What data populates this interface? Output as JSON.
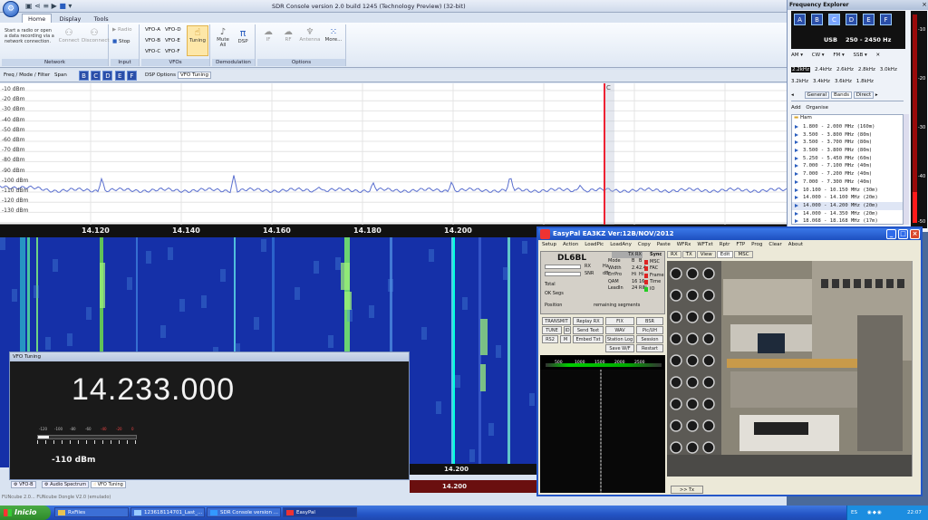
{
  "app": {
    "title": "SDR Console version 2.0 build 1245 (Technology Preview) (32-bit)",
    "tabs": [
      "Home",
      "Display",
      "Tools"
    ],
    "network_text": "Start a radio or open a data recording via a network connection.",
    "groups": {
      "network": {
        "title": "Network",
        "connect": "Connect",
        "disconnect": "Disconnect"
      },
      "input": {
        "title": "Input",
        "radio": "Radio",
        "stop": "Stop"
      },
      "vfos": {
        "title": "VFOs",
        "a": "VFO-A",
        "b": "VFO-B",
        "c": "VFO-C",
        "d": "VFO-D",
        "e": "VFO-E",
        "f": "VFO-F",
        "tuning": "Tuning"
      },
      "demod": {
        "title": "Demodulation",
        "mute": "Mute All",
        "dsp": "DSP"
      },
      "options": {
        "title": "Options",
        "if": "IF",
        "rf": "RF",
        "antenna": "Antenna",
        "more": "More..."
      }
    },
    "toolbar2": {
      "freq_mode": "Freq / Mode / Filter",
      "span": "Span",
      "letters": [
        "B",
        "C",
        "D",
        "E",
        "F"
      ],
      "dsp_options": "DSP Options",
      "vfo_tuning": "VFO Tuning"
    }
  },
  "spectrum": {
    "db_labels": [
      "-10 dBm",
      "-20 dBm",
      "-30 dBm",
      "-40 dBm",
      "-50 dBm",
      "-60 dBm",
      "-70 dBm",
      "-80 dBm",
      "-90 dBm",
      "-100 dBm",
      "-110 dBm",
      "-120 dBm",
      "-130 dBm"
    ],
    "freq_labels": [
      "14.120",
      "14.140",
      "14.160",
      "14.180",
      "14.200"
    ],
    "marker": "C",
    "trace_color": "#5a6fcf"
  },
  "waterfall": {
    "scale_label_1": "14.200",
    "scale_label_2": "14.200",
    "bg_color": "#1530a8",
    "trace_color": "#00ffe0"
  },
  "vfo_tuning": {
    "title": "VFO Tuning",
    "frequency": "14.233.000",
    "smeter_scale": [
      "-120",
      "-100",
      "-80",
      "-60",
      "-40",
      "-20",
      "0"
    ],
    "level": "-110 dBm"
  },
  "bottom_tabs": [
    "VFO-B",
    "Audio Spectrum",
    "VFO Tuning"
  ],
  "status": "FUNcube 2.0... FUNcube Dongle V2.0 (emulado)",
  "freq_explorer": {
    "title": "Frequency Explorer",
    "letters": [
      "A",
      "B",
      "C",
      "D",
      "E",
      "F"
    ],
    "mode": "USB",
    "range": "250 - 2450 Hz",
    "modes": [
      "AM",
      "CW",
      "FM",
      "SSB"
    ],
    "bw_row1": [
      "2.2kHz",
      "2.4kHz",
      "2.6kHz",
      "2.8kHz",
      "3.0kHz"
    ],
    "bw_row2": [
      "3.2kHz",
      "3.4kHz",
      "3.6kHz",
      "1.8kHz"
    ],
    "tabs": [
      "General",
      "Bands",
      "Direct"
    ],
    "actions": [
      "Add",
      "Organise"
    ],
    "group": "Ham",
    "bands": [
      "1.800 - 2.000 MHz (160m)",
      "3.500 - 3.800 MHz (80m)",
      "3.500 - 3.700 MHz (80m)",
      "3.500 - 3.800 MHz (80m)",
      "5.250 - 5.450 MHz (60m)",
      "7.000 - 7.100 MHz (40m)",
      "7.000 - 7.200 MHz (40m)",
      "7.000 - 7.300 MHz (40m)",
      "10.100 - 10.150 MHz (30m)",
      "14.000 - 14.100 MHz (20m)",
      "14.000 - 14.200 MHz (20m)",
      "14.000 - 14.350 MHz (20m)",
      "18.068 - 18.168 MHz (17m)"
    ],
    "meter_labels": [
      "-10",
      "-20",
      "-30",
      "-40",
      "-50"
    ]
  },
  "easypal": {
    "title": "EasyPal  EA3KZ  Ver:12B/NOV/2012",
    "menu": [
      "Setup",
      "Action",
      "LoadPic",
      "LoadAny",
      "Copy",
      "Paste",
      "WFRx",
      "WFTxt",
      "Rptr",
      "FTP",
      "Prog",
      "Clear",
      "About"
    ],
    "callsign": "DL6BL",
    "labels": {
      "rx": "RX",
      "hz": "Hz",
      "snr": "SNR",
      "db": "dB",
      "total": "Total",
      "ok_segs": "OK Segs",
      "position": "Position",
      "remaining": "remaining segments"
    },
    "mode_table": {
      "rows": [
        [
          "Mode",
          "B",
          "B"
        ],
        [
          "Width",
          "2.4",
          "2.4"
        ],
        [
          "ErrPro",
          "Hi",
          "Hi"
        ],
        [
          "QAM",
          "16",
          "16"
        ],
        [
          "LeadIn",
          "24",
          "RIN"
        ]
      ],
      "headers": [
        "TX",
        "RX"
      ]
    },
    "sync": [
      "Sync",
      "MSC",
      "FAC",
      "Frame",
      "Time",
      "IO"
    ],
    "buttons": [
      "TRANSMIT",
      "Replay RX",
      "FIX",
      "BSR",
      "TUNE",
      "ID",
      "Send Text",
      "WAV",
      "Pic/UH",
      "RS2",
      "M",
      "Embed Txt",
      "Station Log",
      "Session",
      "Save W/F",
      "Restart"
    ],
    "spectrum_scale": [
      "500",
      "1000",
      "1500",
      "2000",
      "2500"
    ],
    "tabs": [
      "RX",
      "TX",
      "View",
      "Edit",
      "MSC"
    ],
    "footer_btn": ">> Tx"
  },
  "taskbar": {
    "start": "Inicio",
    "items": [
      "RxFiles",
      "123618114701_Last_...",
      "SDR Console version ...",
      "EasyPal"
    ],
    "lang": "ES",
    "clock": "22:07"
  }
}
